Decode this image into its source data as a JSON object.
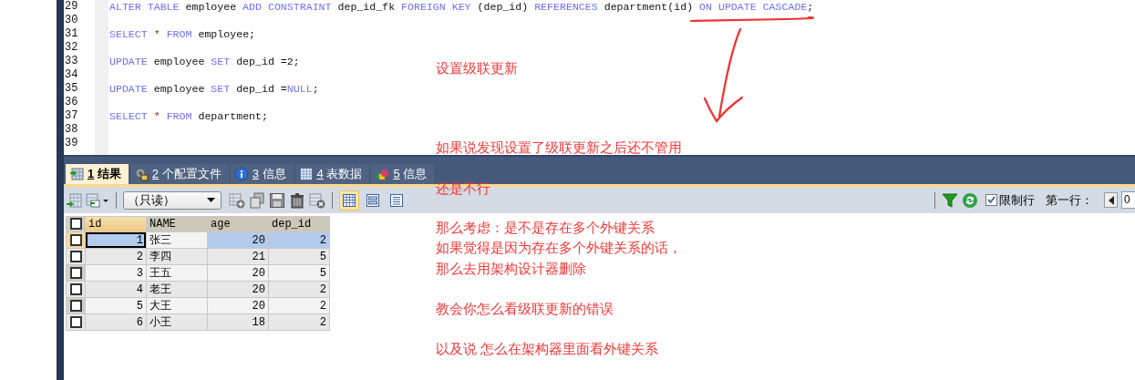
{
  "editor": {
    "lines": [
      {
        "number": "29",
        "tokens": [
          {
            "kind": "kw",
            "text": "ALTER TABLE"
          },
          {
            "kind": "id",
            "text": " employee "
          },
          {
            "kind": "kw",
            "text": "ADD CONSTRAINT"
          },
          {
            "kind": "id",
            "text": " dep_id_fk "
          },
          {
            "kind": "kw",
            "text": "FOREIGN KEY"
          },
          {
            "kind": "id",
            "text": " (dep_id) "
          },
          {
            "kind": "kw",
            "text": "REFERENCES"
          },
          {
            "kind": "id",
            "text": " department(id) "
          },
          {
            "kind": "kw",
            "text": "ON UPDATE CASCADE"
          },
          {
            "kind": "id",
            "text": ";"
          }
        ]
      },
      {
        "number": "30"
      },
      {
        "number": "31",
        "tokens": [
          {
            "kind": "kw",
            "text": "SELECT"
          },
          {
            "kind": "op",
            "text": " * "
          },
          {
            "kind": "kw",
            "text": "FROM"
          },
          {
            "kind": "id",
            "text": " employee;"
          }
        ]
      },
      {
        "number": "32"
      },
      {
        "number": "33",
        "tokens": [
          {
            "kind": "kw",
            "text": "UPDATE"
          },
          {
            "kind": "id",
            "text": " employee "
          },
          {
            "kind": "kw",
            "text": "SET"
          },
          {
            "kind": "id",
            "text": " dep_id =2;"
          }
        ]
      },
      {
        "number": "34"
      },
      {
        "number": "35",
        "tokens": [
          {
            "kind": "kw",
            "text": "UPDATE"
          },
          {
            "kind": "id",
            "text": " employee "
          },
          {
            "kind": "kw",
            "text": "SET"
          },
          {
            "kind": "id",
            "text": " dep_id ="
          },
          {
            "kind": "kw",
            "text": "NULL"
          },
          {
            "kind": "id",
            "text": ";"
          }
        ]
      },
      {
        "number": "36"
      },
      {
        "number": "37",
        "tokens": [
          {
            "kind": "kw",
            "text": "SELECT"
          },
          {
            "kind": "op",
            "text": " * "
          },
          {
            "kind": "kw",
            "text": "FROM"
          },
          {
            "kind": "id",
            "text": " department;"
          }
        ]
      },
      {
        "number": "38"
      },
      {
        "number": "39"
      }
    ]
  },
  "result_tabs": [
    {
      "kind": "result",
      "key": "1",
      "label": "结果",
      "selected": true
    },
    {
      "kind": "profile",
      "key": "2",
      "label": "个配置文件",
      "selected": false
    },
    {
      "kind": "info",
      "key": "3",
      "label": "信息",
      "selected": false
    },
    {
      "kind": "table",
      "key": "4",
      "label": "表数据",
      "selected": false
    },
    {
      "kind": "shapes",
      "key": "5",
      "label": "信息",
      "selected": false
    }
  ],
  "toolbar": {
    "mode_select": "（只读）",
    "view_buttons": [
      {
        "kind": "grid",
        "selected": true
      },
      {
        "kind": "form",
        "selected": false
      },
      {
        "kind": "text",
        "selected": false
      }
    ],
    "limit_rows": {
      "label": "限制行",
      "checked": true
    },
    "first_row_label": "第一行：",
    "first_row_value": "0"
  },
  "grid": {
    "all_checked": false,
    "columns": [
      "id",
      "NAME",
      "age",
      "dep_id"
    ],
    "rows": [
      {
        "cells": [
          "1",
          "张三",
          "20",
          "2"
        ],
        "selected": true,
        "checked": false
      },
      {
        "cells": [
          "2",
          "李四",
          "21",
          "5"
        ],
        "selected": false,
        "checked": false
      },
      {
        "cells": [
          "3",
          "王五",
          "20",
          "5"
        ],
        "selected": false,
        "checked": false
      },
      {
        "cells": [
          "4",
          "老王",
          "20",
          "2"
        ],
        "selected": false,
        "checked": false
      },
      {
        "cells": [
          "5",
          "大王",
          "20",
          "2"
        ],
        "selected": false,
        "checked": false
      },
      {
        "cells": [
          "6",
          "小王",
          "18",
          "2"
        ],
        "selected": false,
        "checked": false
      }
    ]
  },
  "annotations": [
    "设置级联更新",
    "如果说发现设置了级联更新之后还不管用",
    "还是不行",
    "那么考虑：是不是存在多个外键关系",
    "如果觉得是因为存在多个外键关系的话，",
    "那么去用架构设计器删除",
    "教会你怎么看级联更新的错误",
    "以及说  怎么在架构器里面看外键关系"
  ]
}
